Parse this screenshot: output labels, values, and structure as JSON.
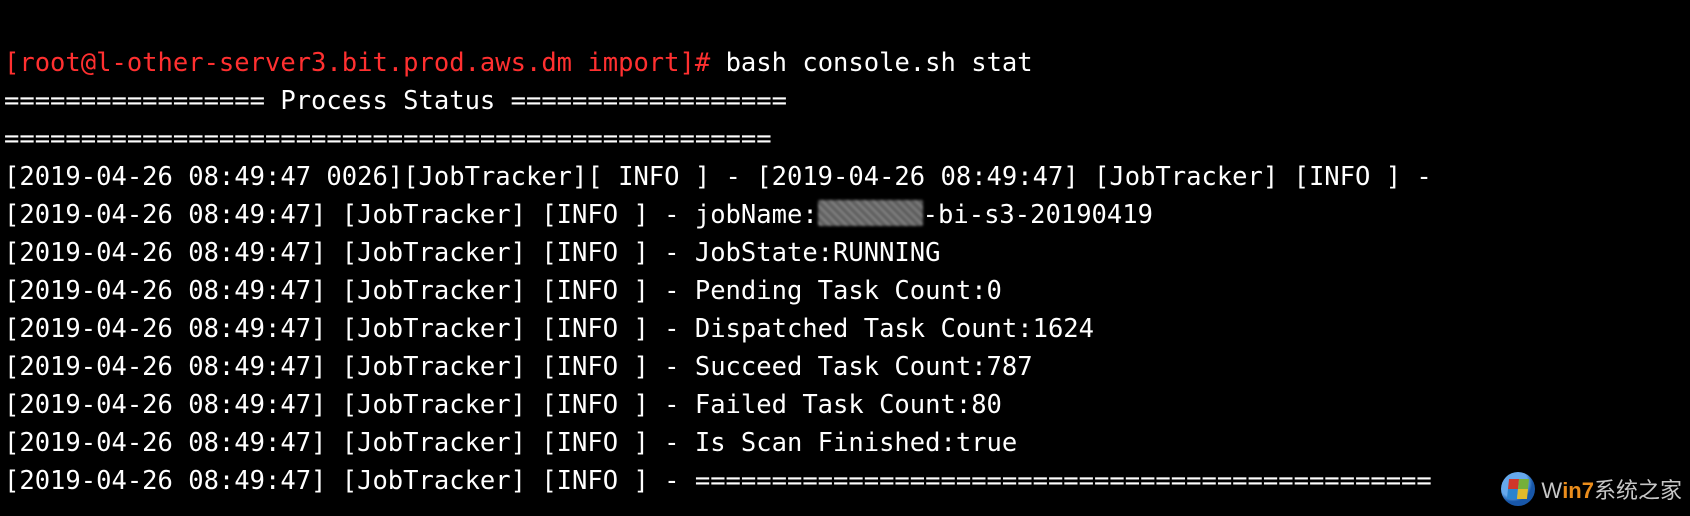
{
  "prompt": {
    "user_host_path": "[root@l-other-server3.bit.prod.aws.dm import]#",
    "command": "bash console.sh stat"
  },
  "header": {
    "status_line": "================= Process Status ==================",
    "divider": "=================================================="
  },
  "censored_placeholder": "",
  "log_lines": [
    "[2019-04-26 08:49:47 0026][JobTracker][ INFO ] - [2019-04-26 08:49:47] [JobTracker] [INFO ] -",
    "[2019-04-26 08:49:47] [JobTracker] [INFO ] - jobName:{{CENSOR}}-bi-s3-20190419",
    "[2019-04-26 08:49:47] [JobTracker] [INFO ] - JobState:RUNNING",
    "[2019-04-26 08:49:47] [JobTracker] [INFO ] - Pending Task Count:0",
    "[2019-04-26 08:49:47] [JobTracker] [INFO ] - Dispatched Task Count:1624",
    "[2019-04-26 08:49:47] [JobTracker] [INFO ] - Succeed Task Count:787",
    "[2019-04-26 08:49:47] [JobTracker] [INFO ] - Failed Task Count:80",
    "[2019-04-26 08:49:47] [JobTracker] [INFO ] - Is Scan Finished:true",
    "[2019-04-26 08:49:47] [JobTracker] [INFO ] - ================================================"
  ],
  "watermark": {
    "prefix": "W",
    "accent": "in7",
    "suffix": "系统之家"
  }
}
